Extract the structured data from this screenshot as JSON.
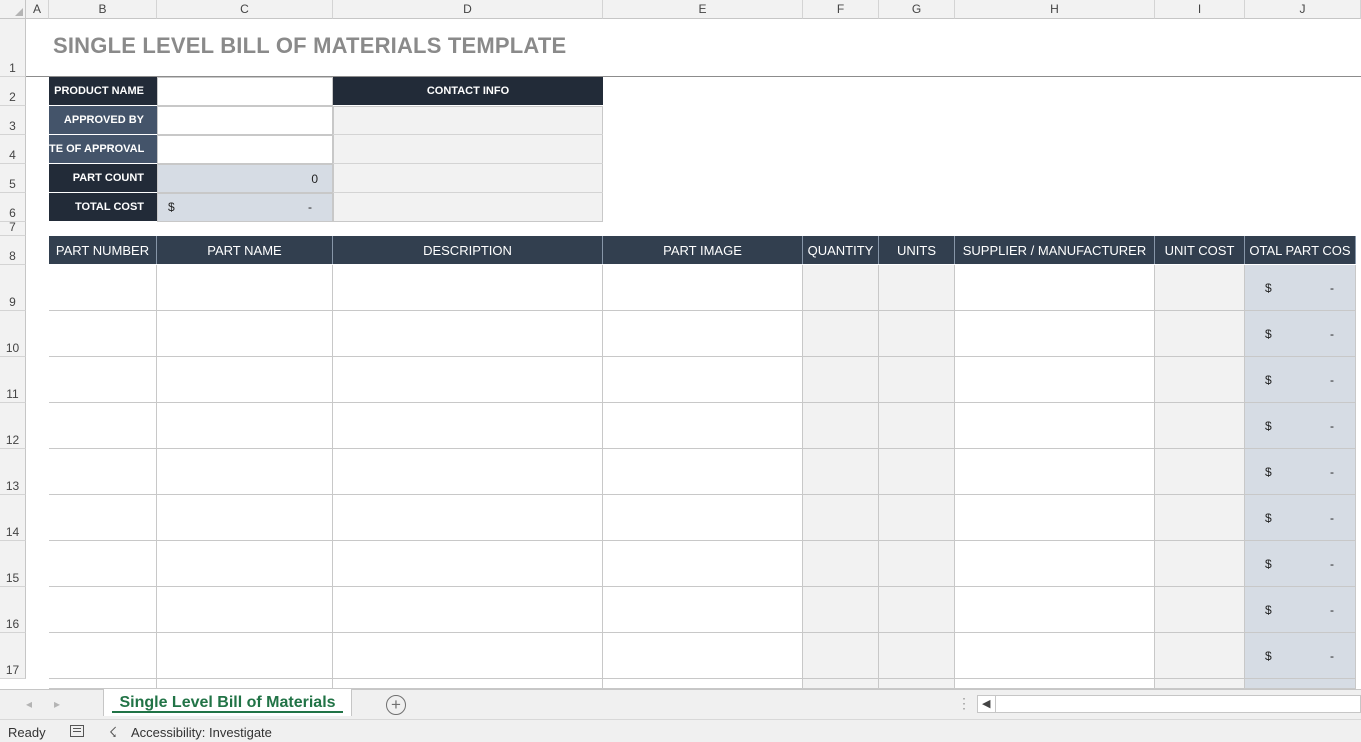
{
  "columns": [
    "A",
    "B",
    "C",
    "D",
    "E",
    "F",
    "G",
    "H",
    "I",
    "J"
  ],
  "rows": [
    "1",
    "2",
    "3",
    "4",
    "5",
    "6",
    "7",
    "8",
    "9",
    "10",
    "11",
    "12",
    "13",
    "14",
    "15",
    "16",
    "17"
  ],
  "title": "SINGLE LEVEL BILL OF MATERIALS TEMPLATE",
  "info": {
    "product_name": "PRODUCT NAME",
    "approved_by": "APPROVED BY",
    "date_of_approval": "TE OF APPROVAL",
    "part_count": "PART COUNT",
    "part_count_value": "0",
    "total_cost": "TOTAL COST",
    "total_cost_symbol": "$",
    "total_cost_value": "-",
    "contact_info": "CONTACT INFO"
  },
  "table": {
    "headers": [
      "PART NUMBER",
      "PART NAME",
      "DESCRIPTION",
      "PART IMAGE",
      "QUANTITY",
      "UNITS",
      "SUPPLIER / MANUFACTURER",
      "UNIT COST",
      "OTAL PART COS"
    ],
    "row_symbol": "$",
    "row_value": "-"
  },
  "sheet_tab": "Single Level Bill of Materials",
  "status": {
    "ready": "Ready",
    "accessibility": "Accessibility: Investigate"
  },
  "colors": {
    "header_dark": "#323f4f",
    "label_dark": "#222b38",
    "label_mid": "#44546a",
    "total_fill": "#d6dce4",
    "accent_green": "#217346"
  }
}
